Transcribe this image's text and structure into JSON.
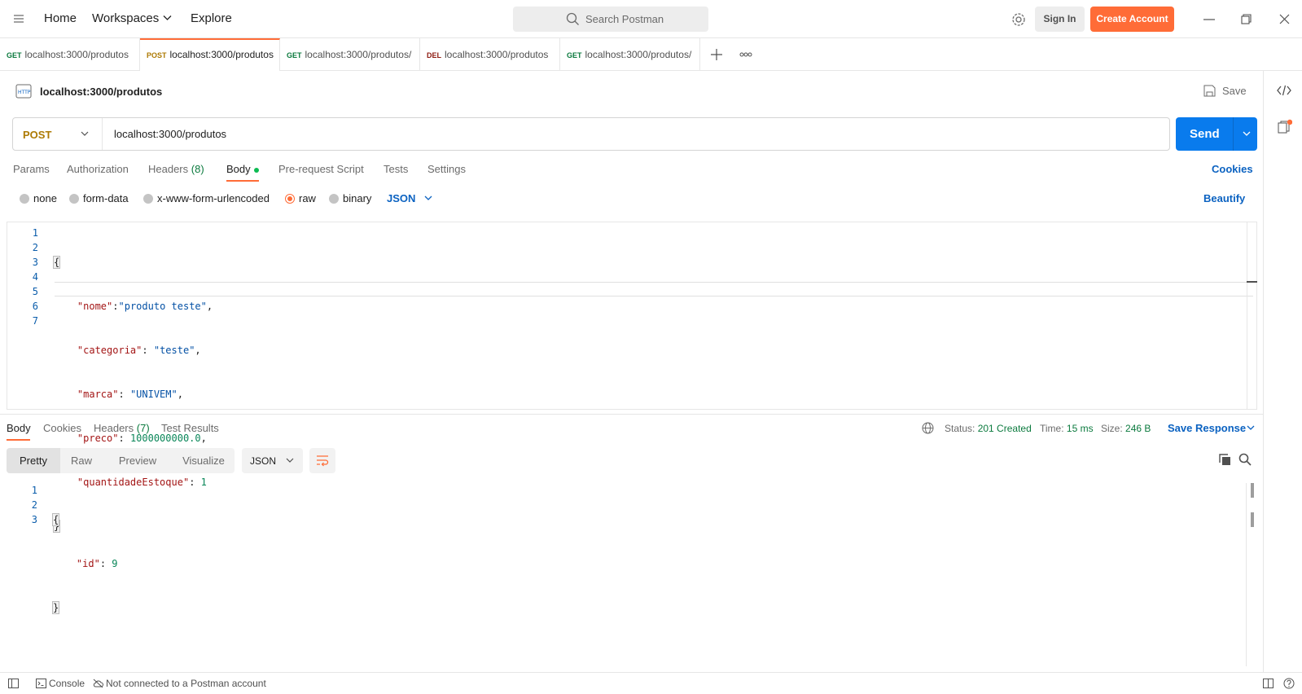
{
  "topbar": {
    "nav": [
      "Home",
      "Workspaces",
      "Explore"
    ],
    "search_placeholder": "Search Postman",
    "sign_in": "Sign In",
    "create_account": "Create Account"
  },
  "tabs": [
    {
      "method": "GET",
      "url": "localhost:3000/produtos"
    },
    {
      "method": "POST",
      "url": "localhost:3000/produtos"
    },
    {
      "method": "GET",
      "url": "localhost:3000/produtos/"
    },
    {
      "method": "DEL",
      "url": "localhost:3000/produtos"
    },
    {
      "method": "GET",
      "url": "localhost:3000/produtos/"
    }
  ],
  "request": {
    "name": "localhost:3000/produtos",
    "save_label": "Save",
    "method": "POST",
    "url": "localhost:3000/produtos",
    "send_label": "Send",
    "subtabs": {
      "params": "Params",
      "authorization": "Authorization",
      "headers": "Headers",
      "headers_count": "(8)",
      "body": "Body",
      "prerequest": "Pre-request Script",
      "tests": "Tests",
      "settings": "Settings",
      "cookies": "Cookies"
    },
    "body_modes": [
      "none",
      "form-data",
      "x-www-form-urlencoded",
      "raw",
      "binary"
    ],
    "body_format": "JSON",
    "beautify": "Beautify",
    "body_lines": {
      "l1": "{",
      "k2": "\"nome\"",
      "v2": "\"produto teste\"",
      "k3": "\"categoria\"",
      "v3": "\"teste\"",
      "k4": "\"marca\"",
      "v4": "\"UNIVEM\"",
      "k5": "\"preco\"",
      "v5": "1000000000.0",
      "k6": "\"quantidadeEstoque\"",
      "v6": "1",
      "l7": "}"
    }
  },
  "response": {
    "tabs": {
      "body": "Body",
      "cookies": "Cookies",
      "headers": "Headers",
      "headers_count": "(7)",
      "tests": "Test Results"
    },
    "status_label": "Status:",
    "status_value": "201 Created",
    "time_label": "Time:",
    "time_value": "15 ms",
    "size_label": "Size:",
    "size_value": "246 B",
    "save_response": "Save Response",
    "views": [
      "Pretty",
      "Raw",
      "Preview",
      "Visualize"
    ],
    "format": "JSON",
    "body_lines": {
      "l1": "{",
      "k2": "\"id\"",
      "v2": "9",
      "l3": "}"
    }
  },
  "footer": {
    "console": "Console",
    "connection": "Not connected to a Postman account"
  },
  "colors": {
    "accent": "#ff6c37",
    "send_blue": "#097bed",
    "link_blue": "#0b62c1",
    "success_green": "#0b7a3e"
  }
}
